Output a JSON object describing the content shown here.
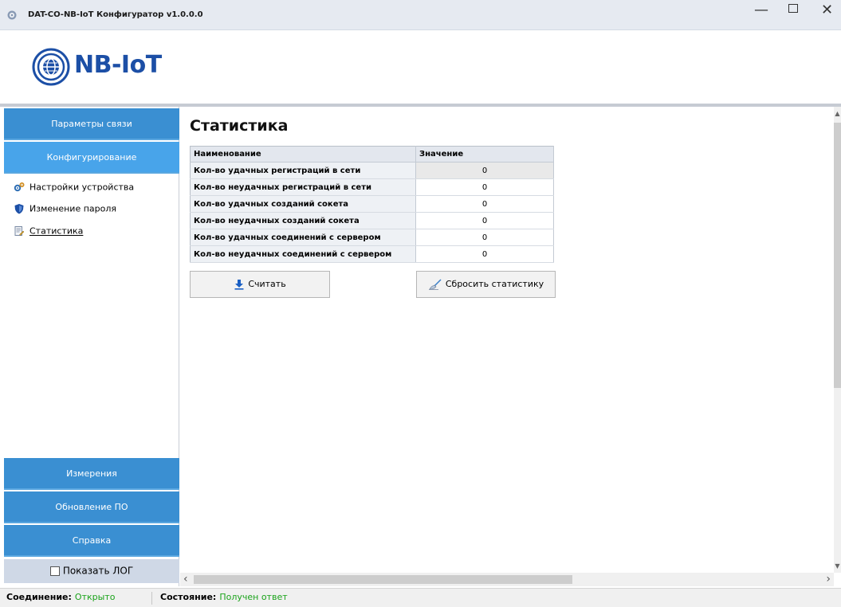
{
  "window": {
    "title": "DAT-CO-NB-IoT Конфигуратор v1.0.0.0",
    "minimize": "—",
    "close": "✕"
  },
  "header": {
    "logo_text": "NB-IoT",
    "brand_color": "#1c4fa6"
  },
  "sidebar": {
    "nav": {
      "comm": "Параметры связи",
      "config": "Конфигурирование",
      "measure": "Измерения",
      "update": "Обновление ПО",
      "help": "Справка"
    },
    "subitems": [
      {
        "label": "Настройки устройства",
        "icon": "gears-icon"
      },
      {
        "label": "Изменение пароля",
        "icon": "shield-icon"
      },
      {
        "label": "Статистика",
        "icon": "document-edit-icon"
      }
    ],
    "show_log": {
      "label": "Показать ЛОГ",
      "checked": false
    },
    "nav_color": "#3a8fd2",
    "nav_active_color": "#48a4ea"
  },
  "main": {
    "title": "Статистика",
    "table": {
      "columns": [
        "Наименование",
        "Значение"
      ],
      "rows": [
        {
          "name": "Кол-во удачных регистраций в сети",
          "value": "0"
        },
        {
          "name": "Кол-во неудачных регистраций в сети",
          "value": "0"
        },
        {
          "name": "Кол-во удачных созданий сокета",
          "value": "0"
        },
        {
          "name": "Кол-во неудачных созданий сокета",
          "value": "0"
        },
        {
          "name": "Кол-во удачных соединений с сервером",
          "value": "0"
        },
        {
          "name": "Кол-во неудачных соединений с сервером",
          "value": "0"
        }
      ]
    },
    "buttons": {
      "read": {
        "label": "Считать",
        "icon": "download-arrow-icon"
      },
      "reset": {
        "label": "Сбросить статистику",
        "icon": "broom-icon"
      }
    }
  },
  "status": {
    "connection_key": "Соединение:",
    "connection_value": "Открыто",
    "state_key": "Состояние:",
    "state_value": "Получен ответ",
    "ok_color": "#1aa31a"
  }
}
